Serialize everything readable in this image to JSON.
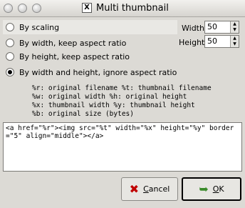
{
  "window": {
    "title": "Multi thumbnail",
    "app_icon": "X"
  },
  "options": [
    {
      "label": "By scaling",
      "selected": false
    },
    {
      "label": "By width, keep aspect ratio",
      "selected": false
    },
    {
      "label": "By height, keep aspect ratio",
      "selected": false
    },
    {
      "label": "By width and height, ignore aspect ratio",
      "selected": true
    }
  ],
  "width": {
    "label": "Width",
    "value": "50"
  },
  "height": {
    "label": "Height",
    "value": "50"
  },
  "help_lines": [
    "%r: original filename  %t: thumbnail filename",
    "%w: original width  %h: original height",
    "%x: thumbnail width  %y: thumbnail height",
    "%b: original size (bytes)"
  ],
  "template_text": "<a href=\"%r\"><img src=\"%t\" width=\"%x\" height=\"%y\" border=\"5\" align=\"middle\"></a>",
  "buttons": {
    "cancel": {
      "label_u": "C",
      "label_rest": "ancel"
    },
    "ok": {
      "label_u": "O",
      "label_rest": "K"
    }
  }
}
